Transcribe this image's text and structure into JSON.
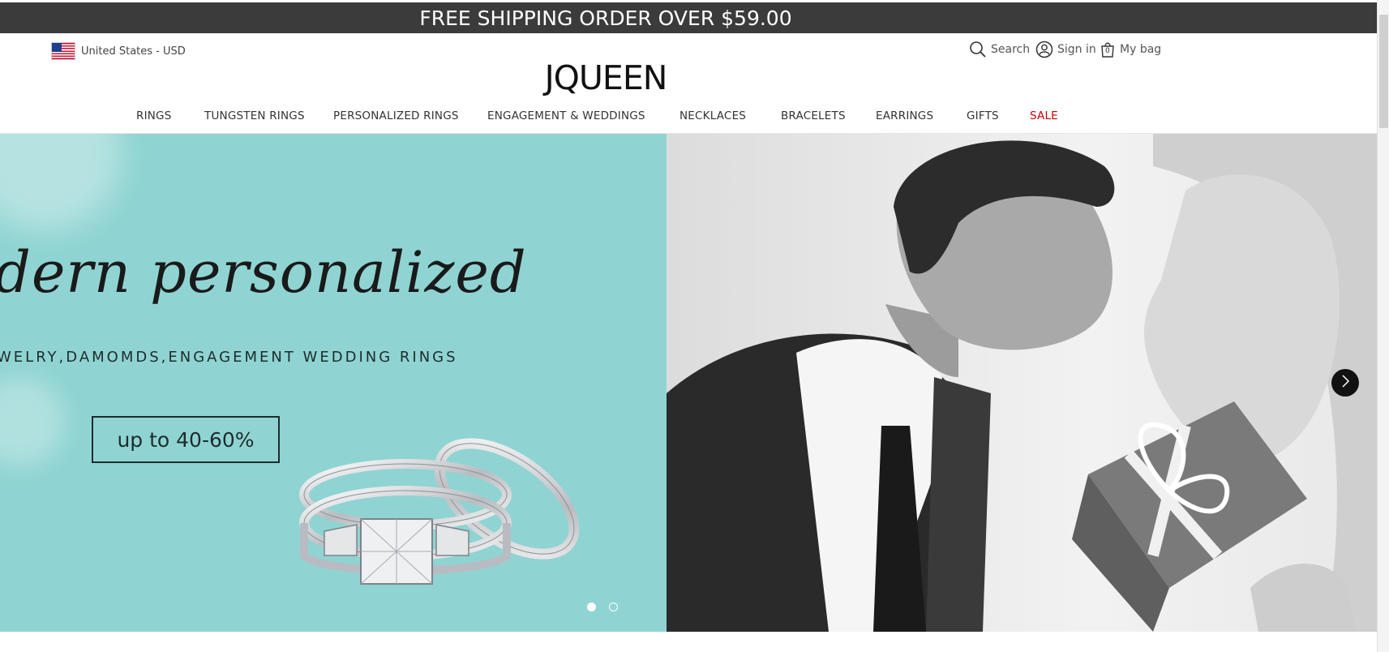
{
  "top_bar": {
    "text": "FREE SHIPPING ORDER OVER $59.00"
  },
  "locale": {
    "label": "United States - USD",
    "flag_icon": "us-flag-icon"
  },
  "utility": {
    "search_label": "Search",
    "signin_label": "Sign in",
    "bag_label": "My bag",
    "bag_count": "0"
  },
  "logo": {
    "text": "JQUEEN"
  },
  "nav": {
    "items": [
      {
        "label": "RINGS"
      },
      {
        "label": "TUNGSTEN RINGS"
      },
      {
        "label": "PERSONALIZED RINGS"
      },
      {
        "label": "ENGAGEMENT & WEDDINGS"
      },
      {
        "label": "NECKLACES"
      },
      {
        "label": "BRACELETS"
      },
      {
        "label": "EARRINGS"
      },
      {
        "label": "GIFTS"
      },
      {
        "label": "SALE"
      }
    ]
  },
  "hero": {
    "script_text": "odern personalized",
    "subline": "WELRY,DAMOMDS,ENGAGEMENT WEDDING RINGS",
    "promo_label": "up to 40-60%",
    "slide_count": 2,
    "active_slide": 1
  },
  "colors": {
    "top_bar": "#3b3b3b",
    "hero_teal": "#8fd4d2",
    "sale": "#c40000"
  }
}
